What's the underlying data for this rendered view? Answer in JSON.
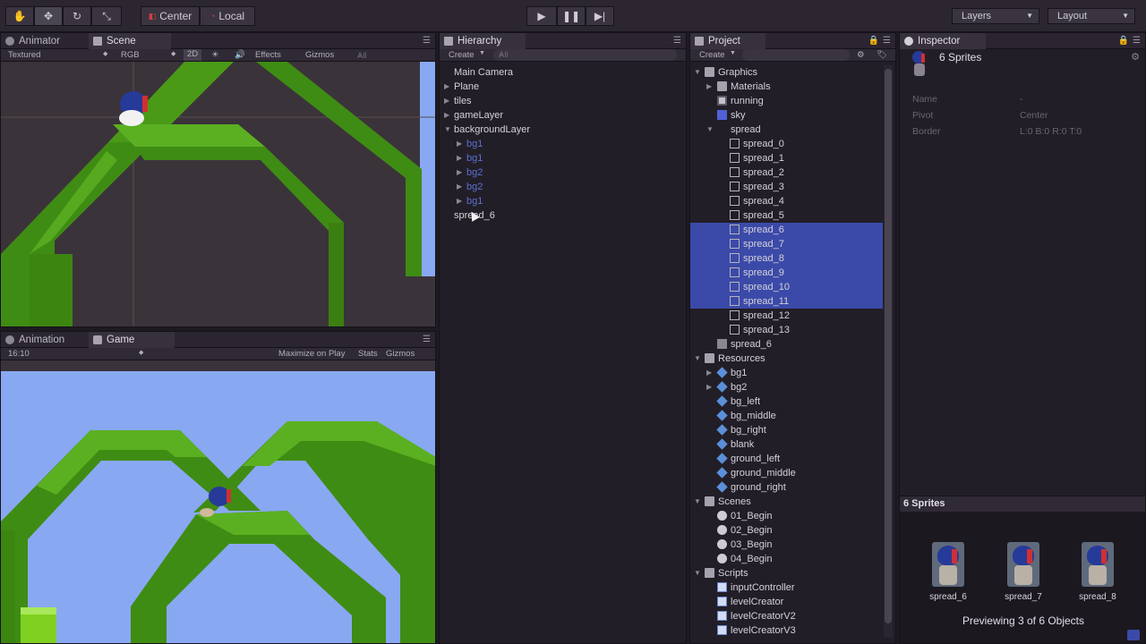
{
  "toolbar": {
    "pivot_label": "Center",
    "space_label": "Local",
    "layers_label": "Layers",
    "layout_label": "Layout"
  },
  "scene_panel": {
    "tabs": [
      "Animator",
      "Scene"
    ],
    "shading": "Textured",
    "render_mode": "RGB",
    "mode_2d": "2D",
    "effects": "Effects",
    "gizmos": "Gizmos",
    "search_placeholder": "All"
  },
  "game_panel": {
    "tabs": [
      "Animation",
      "Game"
    ],
    "aspect": "16:10",
    "maximize": "Maximize on Play",
    "stats": "Stats",
    "gizmos": "Gizmos"
  },
  "hierarchy": {
    "title": "Hierarchy",
    "create": "Create",
    "search_placeholder": "All",
    "items": [
      {
        "label": "Main Camera",
        "indent": 0,
        "expand": "",
        "style": "normal"
      },
      {
        "label": "Plane",
        "indent": 0,
        "expand": "right",
        "style": "normal"
      },
      {
        "label": "tiles",
        "indent": 0,
        "expand": "right",
        "style": "normal"
      },
      {
        "label": "gameLayer",
        "indent": 0,
        "expand": "right",
        "style": "normal"
      },
      {
        "label": "backgroundLayer",
        "indent": 0,
        "expand": "down",
        "style": "normal"
      },
      {
        "label": "bg1",
        "indent": 1,
        "expand": "right",
        "style": "prefab"
      },
      {
        "label": "bg1",
        "indent": 1,
        "expand": "right",
        "style": "prefab"
      },
      {
        "label": "bg2",
        "indent": 1,
        "expand": "right",
        "style": "prefab"
      },
      {
        "label": "bg2",
        "indent": 1,
        "expand": "right",
        "style": "prefab"
      },
      {
        "label": "bg1",
        "indent": 1,
        "expand": "right",
        "style": "prefab"
      },
      {
        "label": "spread_6",
        "indent": 0,
        "expand": "",
        "style": "normal"
      }
    ]
  },
  "project": {
    "title": "Project",
    "create": "Create",
    "items": [
      {
        "label": "Graphics",
        "indent": 0,
        "expand": "down",
        "icon": "folder",
        "selected": false
      },
      {
        "label": "Materials",
        "indent": 1,
        "expand": "right",
        "icon": "folder",
        "selected": false
      },
      {
        "label": "running",
        "indent": 1,
        "expand": "",
        "icon": "mat",
        "selected": false
      },
      {
        "label": "sky",
        "indent": 1,
        "expand": "",
        "icon": "skyicon",
        "selected": false
      },
      {
        "label": "spread",
        "indent": 1,
        "expand": "down",
        "icon": "",
        "selected": false
      },
      {
        "label": "spread_0",
        "indent": 2,
        "expand": "",
        "icon": "sprite",
        "selected": false
      },
      {
        "label": "spread_1",
        "indent": 2,
        "expand": "",
        "icon": "sprite",
        "selected": false
      },
      {
        "label": "spread_2",
        "indent": 2,
        "expand": "",
        "icon": "sprite",
        "selected": false
      },
      {
        "label": "spread_3",
        "indent": 2,
        "expand": "",
        "icon": "sprite",
        "selected": false
      },
      {
        "label": "spread_4",
        "indent": 2,
        "expand": "",
        "icon": "sprite",
        "selected": false
      },
      {
        "label": "spread_5",
        "indent": 2,
        "expand": "",
        "icon": "sprite",
        "selected": false
      },
      {
        "label": "spread_6",
        "indent": 2,
        "expand": "",
        "icon": "sprite",
        "selected": true
      },
      {
        "label": "spread_7",
        "indent": 2,
        "expand": "",
        "icon": "sprite",
        "selected": true
      },
      {
        "label": "spread_8",
        "indent": 2,
        "expand": "",
        "icon": "sprite",
        "selected": true
      },
      {
        "label": "spread_9",
        "indent": 2,
        "expand": "",
        "icon": "sprite",
        "selected": true
      },
      {
        "label": "spread_10",
        "indent": 2,
        "expand": "",
        "icon": "sprite",
        "selected": true
      },
      {
        "label": "spread_11",
        "indent": 2,
        "expand": "",
        "icon": "sprite",
        "selected": true
      },
      {
        "label": "spread_12",
        "indent": 2,
        "expand": "",
        "icon": "sprite",
        "selected": false
      },
      {
        "label": "spread_13",
        "indent": 2,
        "expand": "",
        "icon": "sprite",
        "selected": false
      },
      {
        "label": "spread_6",
        "indent": 1,
        "expand": "",
        "icon": "spritesheet",
        "selected": false
      },
      {
        "label": "Resources",
        "indent": 0,
        "expand": "down",
        "icon": "folder",
        "selected": false
      },
      {
        "label": "bg1",
        "indent": 1,
        "expand": "right",
        "icon": "cube",
        "selected": false
      },
      {
        "label": "bg2",
        "indent": 1,
        "expand": "right",
        "icon": "cube",
        "selected": false
      },
      {
        "label": "bg_left",
        "indent": 1,
        "expand": "",
        "icon": "cube",
        "selected": false
      },
      {
        "label": "bg_middle",
        "indent": 1,
        "expand": "",
        "icon": "cube",
        "selected": false
      },
      {
        "label": "bg_right",
        "indent": 1,
        "expand": "",
        "icon": "cube",
        "selected": false
      },
      {
        "label": "blank",
        "indent": 1,
        "expand": "",
        "icon": "cube",
        "selected": false
      },
      {
        "label": "ground_left",
        "indent": 1,
        "expand": "",
        "icon": "cube",
        "selected": false
      },
      {
        "label": "ground_middle",
        "indent": 1,
        "expand": "",
        "icon": "cube",
        "selected": false
      },
      {
        "label": "ground_right",
        "indent": 1,
        "expand": "",
        "icon": "cube",
        "selected": false
      },
      {
        "label": "Scenes",
        "indent": 0,
        "expand": "down",
        "icon": "folder",
        "selected": false
      },
      {
        "label": "01_Begin",
        "indent": 1,
        "expand": "",
        "icon": "scene",
        "selected": false
      },
      {
        "label": "02_Begin",
        "indent": 1,
        "expand": "",
        "icon": "scene",
        "selected": false
      },
      {
        "label": "03_Begin",
        "indent": 1,
        "expand": "",
        "icon": "scene",
        "selected": false
      },
      {
        "label": "04_Begin",
        "indent": 1,
        "expand": "",
        "icon": "scene",
        "selected": false
      },
      {
        "label": "Scripts",
        "indent": 0,
        "expand": "down",
        "icon": "folder",
        "selected": false
      },
      {
        "label": "inputController",
        "indent": 1,
        "expand": "",
        "icon": "script",
        "selected": false
      },
      {
        "label": "levelCreator",
        "indent": 1,
        "expand": "",
        "icon": "script",
        "selected": false
      },
      {
        "label": "levelCreatorV2",
        "indent": 1,
        "expand": "",
        "icon": "script",
        "selected": false
      },
      {
        "label": "levelCreatorV3",
        "indent": 1,
        "expand": "",
        "icon": "script",
        "selected": false
      }
    ]
  },
  "inspector": {
    "title": "Inspector",
    "header": "6 Sprites",
    "fields": [
      {
        "label": "Name",
        "value": "-"
      },
      {
        "label": "Pivot",
        "value": "Center"
      },
      {
        "label": "Border",
        "value": "L:0 B:0 R:0 T:0"
      }
    ],
    "preview_title": "6 Sprites",
    "previews": [
      "spread_6",
      "spread_7",
      "spread_8"
    ],
    "preview_status": "Previewing 3 of 6 Objects"
  },
  "colors": {
    "selection": "#3b4aa8",
    "prefab_text": "#5c6fd0",
    "sky": "#89a8f2",
    "grass": "#3f8c14"
  }
}
